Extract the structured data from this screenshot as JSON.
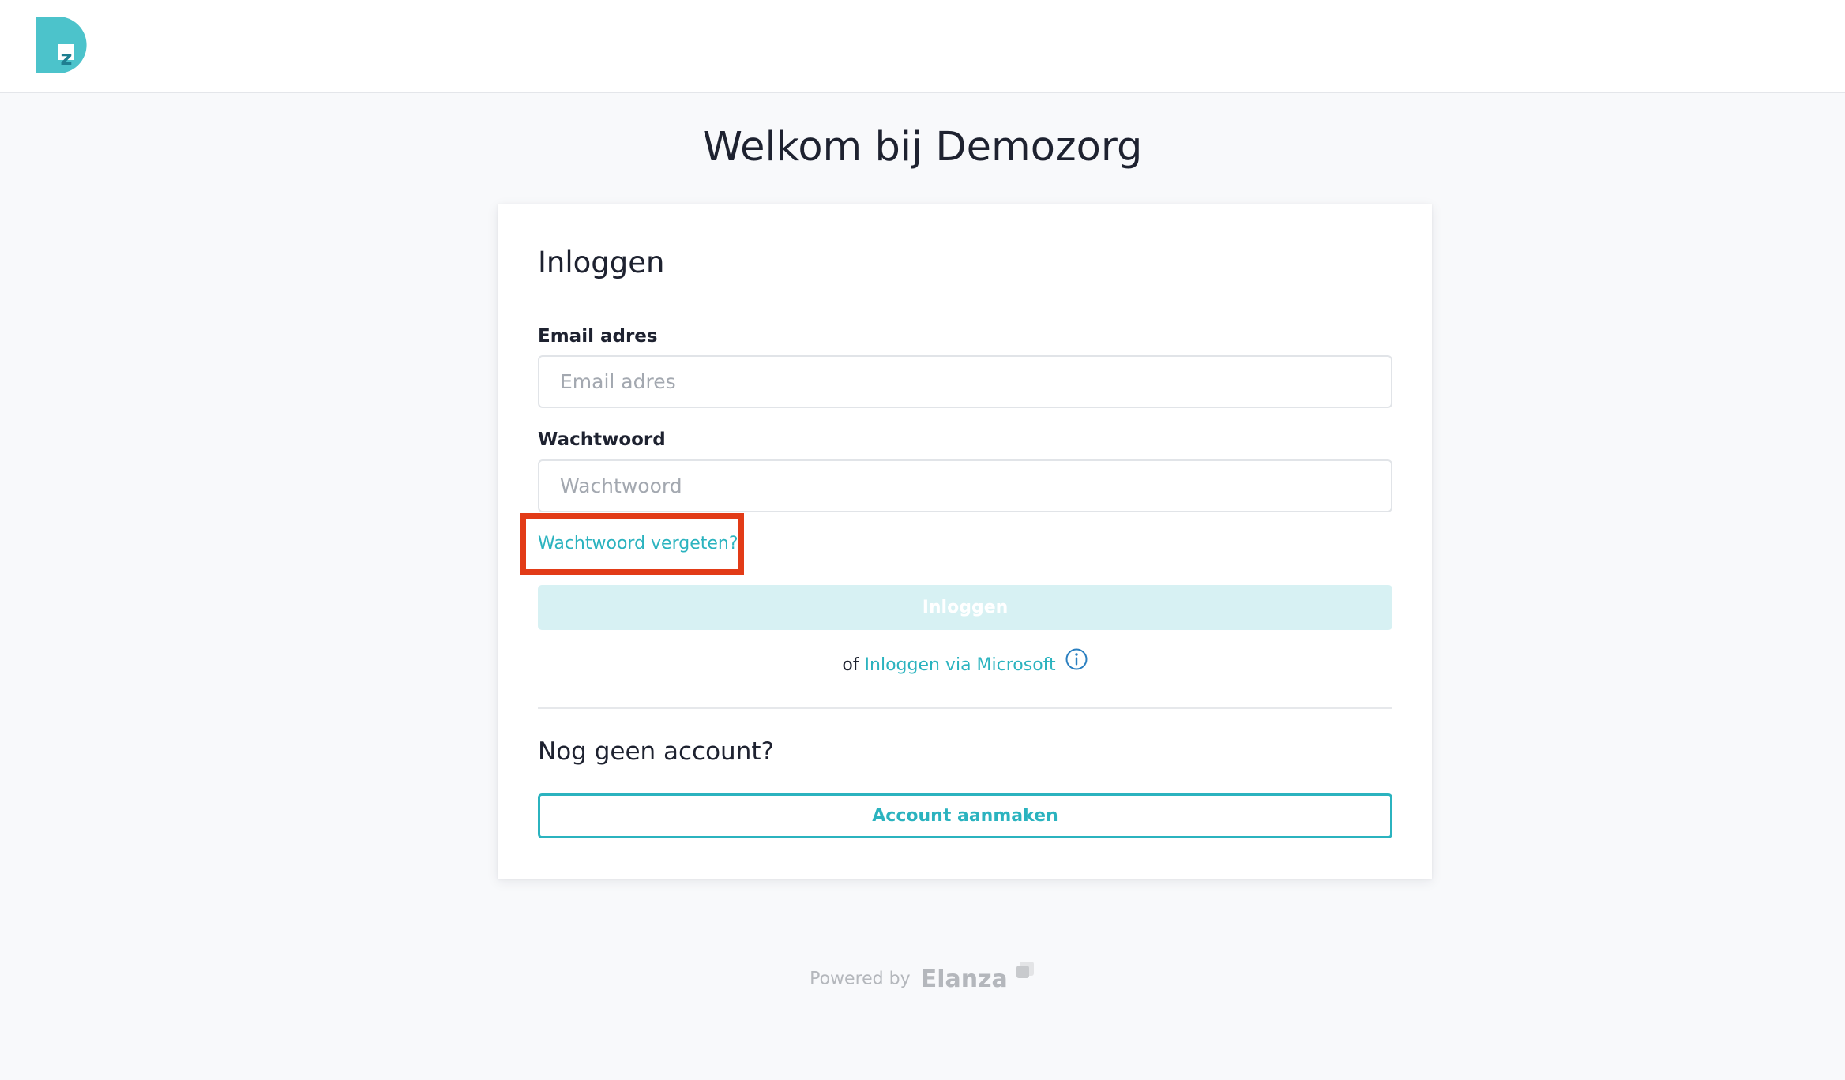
{
  "header": {
    "logo_icon": "demozorg-dz-logo-icon",
    "brand_color": "#4cc3cb"
  },
  "page": {
    "title": "Welkom bij Demozorg"
  },
  "login_card": {
    "title": "Inloggen",
    "email": {
      "label": "Email adres",
      "placeholder": "Email adres",
      "value": ""
    },
    "password": {
      "label": "Wachtwoord",
      "placeholder": "Wachtwoord",
      "value": ""
    },
    "forgot_password_link": "Wachtwoord vergeten?",
    "highlight_color": "#e23b17",
    "login_button": {
      "label": "Inloggen",
      "state": "disabled"
    },
    "alt_login": {
      "prefix": "of",
      "link": "Inloggen via Microsoft",
      "icon": "info-icon"
    },
    "signup": {
      "heading": "Nog geen account?",
      "button": "Account aanmaken"
    }
  },
  "footer": {
    "powered_by": "Powered by",
    "brand": "Elanza",
    "brand_icon": "elanza-mark-icon"
  },
  "colors": {
    "accent": "#2bb3bf",
    "disabled_button_bg": "#d7f1f3",
    "page_bg": "#f8f9fb",
    "text": "#1e2230"
  }
}
